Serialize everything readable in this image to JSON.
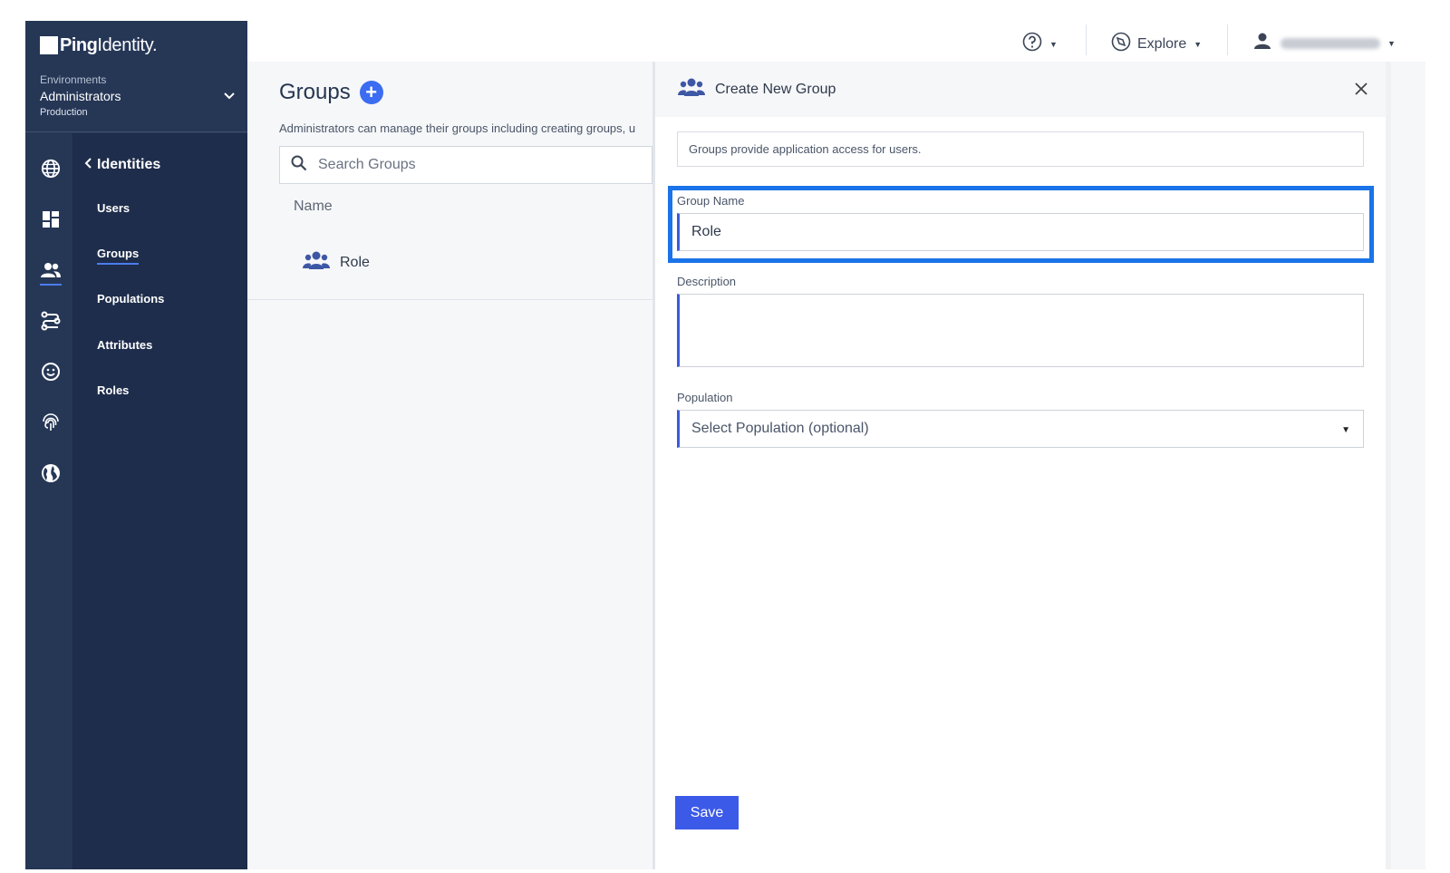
{
  "brand": {
    "name_bold": "Ping",
    "name_light": "Identity."
  },
  "environment": {
    "label": "Environments",
    "name": "Administrators",
    "sub": "Production"
  },
  "rail": {
    "icons": [
      "globe-icon",
      "dashboard-icon",
      "identities-icon",
      "connections-icon",
      "experiences-icon",
      "fingerprint-icon",
      "world-icon"
    ]
  },
  "subnav": {
    "back_label": "Identities",
    "items": [
      {
        "label": "Users"
      },
      {
        "label": "Groups",
        "active": true
      },
      {
        "label": "Populations"
      },
      {
        "label": "Attributes"
      },
      {
        "label": "Roles"
      }
    ]
  },
  "topbar": {
    "explore_label": "Explore"
  },
  "groups_page": {
    "title": "Groups",
    "description": "Administrators can manage their groups including creating groups, u",
    "search_placeholder": "Search Groups",
    "column_name": "Name",
    "rows": [
      {
        "name": "Role"
      }
    ]
  },
  "drawer": {
    "title": "Create New Group",
    "info": "Groups provide application access for users.",
    "group_name_label": "Group Name",
    "group_name_value": "Role",
    "description_label": "Description",
    "description_value": "",
    "population_label": "Population",
    "population_value": "Select Population (optional)",
    "save_label": "Save"
  },
  "colors": {
    "sidebar": "#263756",
    "subnav": "#1e2d4b",
    "accent": "#3c5ae8",
    "focus": "#1a73e8"
  }
}
